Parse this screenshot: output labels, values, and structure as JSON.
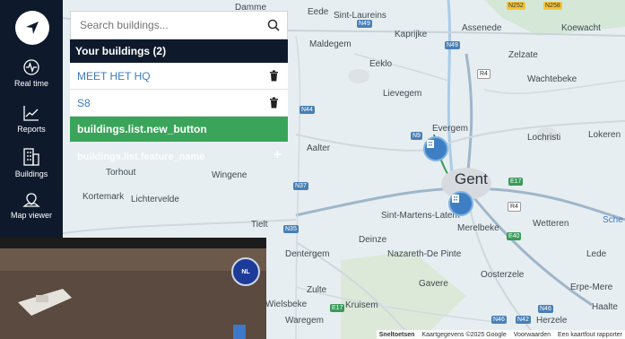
{
  "sidebar": {
    "items": [
      {
        "label": "Real time",
        "icon": "activity-icon"
      },
      {
        "label": "Reports",
        "icon": "chart-line-icon"
      },
      {
        "label": "Buildings",
        "icon": "building-icon"
      },
      {
        "label": "Map viewer",
        "icon": "map-icon"
      }
    ]
  },
  "search": {
    "placeholder": "Search buildings..."
  },
  "buildings": {
    "header": "Your buildings (2)",
    "items": [
      {
        "name": "MEET HET HQ"
      },
      {
        "name": "S8"
      }
    ],
    "new_button": "buildings.list.new_button",
    "feature_overlay": "buildings.list.feature_name"
  },
  "map": {
    "places": [
      "Eede",
      "Sint-Laureins",
      "Kaprijke",
      "Assenede",
      "Maldegem",
      "Zelzate",
      "Koewacht",
      "Eeklo",
      "Wachtebeke",
      "Lievegem",
      "Evergem",
      "Lochristi",
      "Lokeren",
      "Aalter",
      "Gent",
      "Torhout",
      "Wingene",
      "Kortemark",
      "Lichtervelde",
      "Tielt",
      "Sint-Martens-Latem",
      "Merelbeke",
      "Wetteren",
      "Dentergem",
      "Deinze",
      "Nazareth-De Pinte",
      "Lede",
      "Oosterzele",
      "Erpe-Mere",
      "Zulte",
      "Gavere",
      "Wielsbeke",
      "Kruisem",
      "Waregem",
      "Herzele",
      "Haalte",
      "Damme",
      "Sche"
    ],
    "roads": [
      "N252",
      "N258",
      "N49",
      "N49",
      "R4",
      "N44",
      "N9",
      "E17",
      "R4",
      "N37",
      "E40",
      "N35",
      "E403",
      "N35",
      "N42",
      "N46",
      "N46",
      "E17",
      "N37"
    ],
    "footer": [
      "Sneltoetsen",
      "Kaartgegevens ©2025 Google",
      "Voorwaarden",
      "Een kaartfout rapporter"
    ]
  },
  "camera": {
    "badge": "NL"
  },
  "colors": {
    "sidebar": "#0e1a2c",
    "accent_green": "#3aa55a",
    "link_blue": "#3b7bbf",
    "marker": "#3e7fc4"
  }
}
